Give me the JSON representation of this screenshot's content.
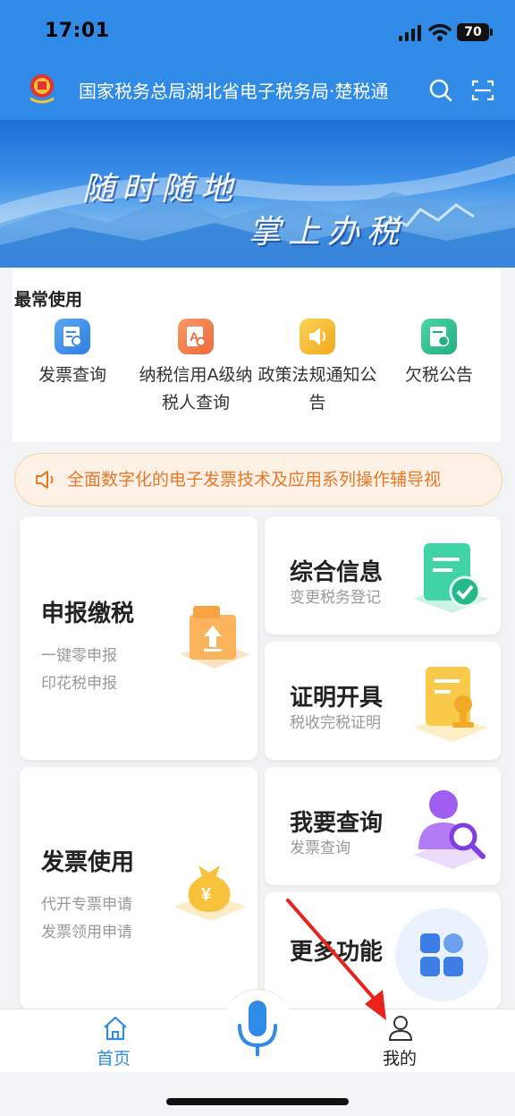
{
  "status_bar": {
    "time": "17:01",
    "battery": "70"
  },
  "header": {
    "title": "国家税务总局湖北省电子税务局·楚税通"
  },
  "banner": {
    "line1": "随时随地",
    "line2": "掌上办税"
  },
  "frequent": {
    "title": "最常使用",
    "items": [
      {
        "label": "发票查询",
        "icon": "invoice-search-icon",
        "color": "#3d8de8"
      },
      {
        "label": "纳税信用A级纳税人查询",
        "icon": "credit-search-icon",
        "color": "#f07a4a"
      },
      {
        "label": "政策法规通知公告",
        "icon": "speaker-icon",
        "color": "#f5b82a"
      },
      {
        "label": "欠税公告",
        "icon": "arrears-icon",
        "color": "#2fbf8f"
      }
    ]
  },
  "notice": {
    "text": "全面数字化的电子发票技术及应用系列操作辅导视"
  },
  "cards": {
    "declare": {
      "title": "申报缴税",
      "subs": [
        "一键零申报",
        "印花税申报"
      ]
    },
    "info": {
      "title": "综合信息",
      "sub": "变更税务登记"
    },
    "cert": {
      "title": "证明开具",
      "sub": "税收完税证明"
    },
    "invoice": {
      "title": "发票使用",
      "subs": [
        "代开专票申请",
        "发票领用申请"
      ]
    },
    "query": {
      "title": "我要查询",
      "sub": "发票查询"
    },
    "more": {
      "title": "更多功能"
    }
  },
  "nav": {
    "home": "首页",
    "me": "我的"
  },
  "colors": {
    "primary": "#2f8be6",
    "notice_text": "#e8782a",
    "arrow": "#e8231c"
  }
}
